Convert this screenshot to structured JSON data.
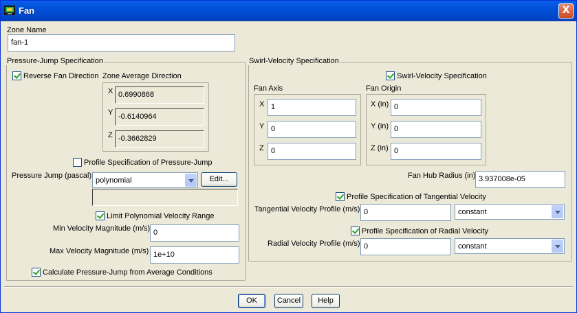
{
  "window": {
    "title": "Fan",
    "close_label": "X",
    "icon": "fluent-app-icon"
  },
  "zone_name": {
    "label": "Zone Name",
    "value": "fan-1"
  },
  "pressure_jump": {
    "title": "Pressure-Jump Specification",
    "reverse_fan": {
      "label": "Reverse Fan Direction",
      "checked": true
    },
    "zone_avg": {
      "title": "Zone Average Direction",
      "x_label": "X",
      "x_value": "0.6990868",
      "y_label": "Y",
      "y_value": "-0.6140964",
      "z_label": "Z",
      "z_value": "-0.3662829"
    },
    "profile_spec": {
      "label": "Profile Specification of Pressure-Jump",
      "checked": false
    },
    "jump_label": "Pressure Jump (pascal)",
    "jump_method": "polynomial",
    "edit_label": "Edit...",
    "jump_profile_value": "",
    "limit_poly": {
      "label": "Limit Polynomial Velocity Range",
      "checked": true
    },
    "min_vel": {
      "label": "Min Velocity Magnitude (m/s)",
      "value": "0"
    },
    "max_vel": {
      "label": "Max Velocity Magnitude (m/s)",
      "value": "1e+10"
    },
    "calc_avg": {
      "label": "Calculate Pressure-Jump from Average Conditions",
      "checked": true
    }
  },
  "swirl": {
    "title": "Swirl-Velocity Specification",
    "enable": {
      "label": "Swirl-Velocity Specification",
      "checked": true
    },
    "fan_axis": {
      "title": "Fan Axis",
      "x_label": "X",
      "x_value": "1",
      "y_label": "Y",
      "y_value": "0",
      "z_label": "Z",
      "z_value": "0"
    },
    "fan_origin": {
      "title": "Fan Origin",
      "x_label": "X (in)",
      "x_value": "0",
      "y_label": "Y (in)",
      "y_value": "0",
      "z_label": "Z (in)",
      "z_value": "0"
    },
    "hub_radius": {
      "label": "Fan Hub Radius (in)",
      "value": "3.937008e-05"
    },
    "tangential_spec": {
      "label": "Profile Specification of Tangential Velocity",
      "checked": true
    },
    "tangential": {
      "label": "Tangential Velocity Profile (m/s)",
      "value": "0",
      "method": "constant"
    },
    "radial_spec": {
      "label": "Profile Specification of Radial Velocity",
      "checked": true
    },
    "radial": {
      "label": "Radial Velocity Profile (m/s)",
      "value": "0",
      "method": "constant"
    }
  },
  "buttons": {
    "ok": "OK",
    "cancel": "Cancel",
    "help": "Help"
  }
}
